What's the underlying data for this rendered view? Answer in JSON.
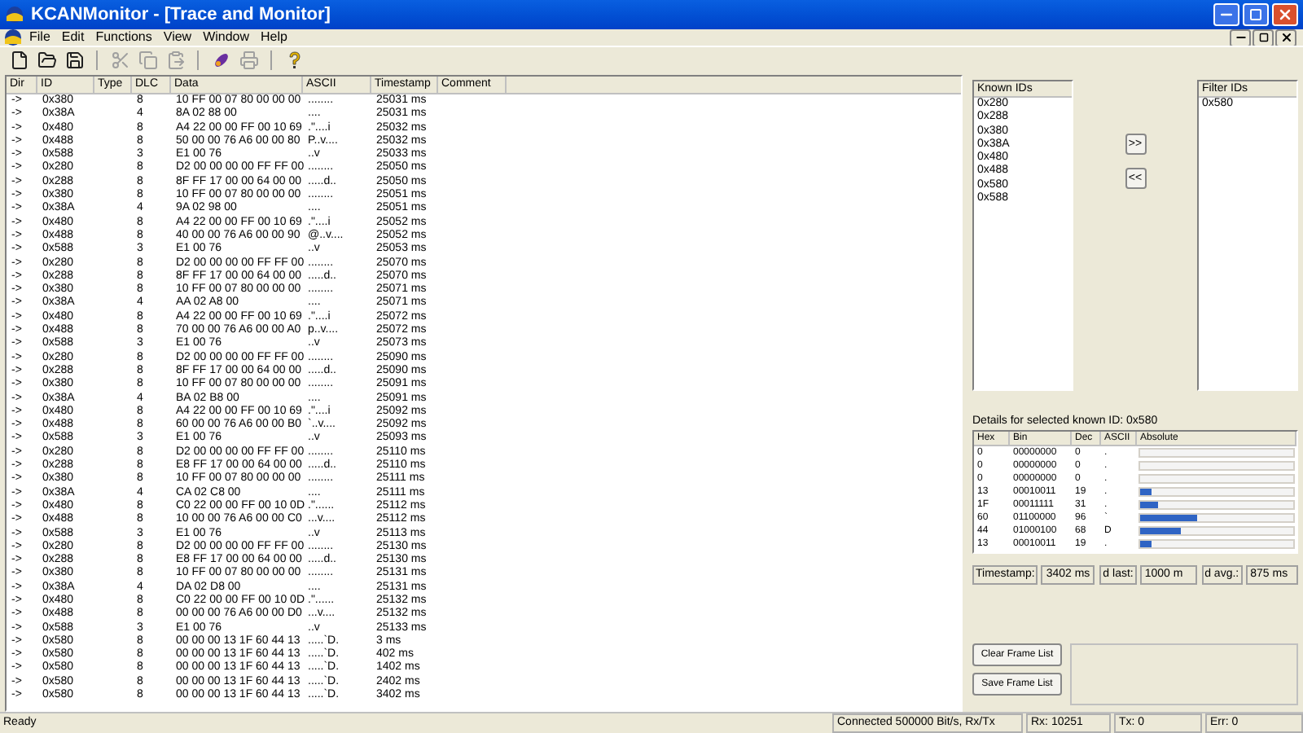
{
  "window": {
    "title": "KCANMonitor - [Trace and Monitor]"
  },
  "menu": [
    "File",
    "Edit",
    "Functions",
    "View",
    "Window",
    "Help"
  ],
  "toolbar": [
    [
      {
        "disabled": false
      },
      {
        "disabled": false
      },
      {
        "disabled": false
      }
    ],
    [
      {
        "disabled": true
      },
      {
        "disabled": true
      },
      {
        "disabled": true
      }
    ],
    [
      {
        "disabled": false
      },
      {
        "disabled": true
      }
    ],
    [
      {
        "disabled": false
      }
    ]
  ],
  "trace": {
    "columns": [
      "Dir",
      "ID",
      "Type",
      "DLC",
      "Data",
      "ASCII",
      "Timestamp",
      "Comment"
    ],
    "rows": [
      {
        "dir": "->",
        "id": "0x380",
        "dlc": "8",
        "data": "10 FF 00 07 80 00 00 00",
        "ascii": "........",
        "timestamp": "25031 ms"
      },
      {
        "dir": "->",
        "id": "0x38A",
        "dlc": "4",
        "data": "8A 02 88 00",
        "ascii": "....",
        "timestamp": "25031 ms"
      },
      {
        "dir": "->",
        "id": "0x480",
        "dlc": "8",
        "data": "A4 22 00 00 FF 00 10 69",
        "ascii": ".\"....i",
        "timestamp": "25032 ms"
      },
      {
        "dir": "->",
        "id": "0x488",
        "dlc": "8",
        "data": "50 00 00 76 A6 00 00 80",
        "ascii": "P..v....",
        "timestamp": "25032 ms"
      },
      {
        "dir": "->",
        "id": "0x588",
        "dlc": "3",
        "data": "E1 00 76",
        "ascii": "..v",
        "timestamp": "25033 ms"
      },
      {
        "dir": "->",
        "id": "0x280",
        "dlc": "8",
        "data": "D2 00 00 00 00 FF FF 00",
        "ascii": "........",
        "timestamp": "25050 ms"
      },
      {
        "dir": "->",
        "id": "0x288",
        "dlc": "8",
        "data": "8F FF 17 00 00 64 00 00",
        "ascii": ".....d..",
        "timestamp": "25050 ms"
      },
      {
        "dir": "->",
        "id": "0x380",
        "dlc": "8",
        "data": "10 FF 00 07 80 00 00 00",
        "ascii": "........",
        "timestamp": "25051 ms"
      },
      {
        "dir": "->",
        "id": "0x38A",
        "dlc": "4",
        "data": "9A 02 98 00",
        "ascii": "....",
        "timestamp": "25051 ms"
      },
      {
        "dir": "->",
        "id": "0x480",
        "dlc": "8",
        "data": "A4 22 00 00 FF 00 10 69",
        "ascii": ".\"....i",
        "timestamp": "25052 ms"
      },
      {
        "dir": "->",
        "id": "0x488",
        "dlc": "8",
        "data": "40 00 00 76 A6 00 00 90",
        "ascii": "@..v....",
        "timestamp": "25052 ms"
      },
      {
        "dir": "->",
        "id": "0x588",
        "dlc": "3",
        "data": "E1 00 76",
        "ascii": "..v",
        "timestamp": "25053 ms"
      },
      {
        "dir": "->",
        "id": "0x280",
        "dlc": "8",
        "data": "D2 00 00 00 00 FF FF 00",
        "ascii": "........",
        "timestamp": "25070 ms"
      },
      {
        "dir": "->",
        "id": "0x288",
        "dlc": "8",
        "data": "8F FF 17 00 00 64 00 00",
        "ascii": ".....d..",
        "timestamp": "25070 ms"
      },
      {
        "dir": "->",
        "id": "0x380",
        "dlc": "8",
        "data": "10 FF 00 07 80 00 00 00",
        "ascii": "........",
        "timestamp": "25071 ms"
      },
      {
        "dir": "->",
        "id": "0x38A",
        "dlc": "4",
        "data": "AA 02 A8 00",
        "ascii": "....",
        "timestamp": "25071 ms"
      },
      {
        "dir": "->",
        "id": "0x480",
        "dlc": "8",
        "data": "A4 22 00 00 FF 00 10 69",
        "ascii": ".\"....i",
        "timestamp": "25072 ms"
      },
      {
        "dir": "->",
        "id": "0x488",
        "dlc": "8",
        "data": "70 00 00 76 A6 00 00 A0",
        "ascii": "p..v....",
        "timestamp": "25072 ms"
      },
      {
        "dir": "->",
        "id": "0x588",
        "dlc": "3",
        "data": "E1 00 76",
        "ascii": "..v",
        "timestamp": "25073 ms"
      },
      {
        "dir": "->",
        "id": "0x280",
        "dlc": "8",
        "data": "D2 00 00 00 00 FF FF 00",
        "ascii": "........",
        "timestamp": "25090 ms"
      },
      {
        "dir": "->",
        "id": "0x288",
        "dlc": "8",
        "data": "8F FF 17 00 00 64 00 00",
        "ascii": ".....d..",
        "timestamp": "25090 ms"
      },
      {
        "dir": "->",
        "id": "0x380",
        "dlc": "8",
        "data": "10 FF 00 07 80 00 00 00",
        "ascii": "........",
        "timestamp": "25091 ms"
      },
      {
        "dir": "->",
        "id": "0x38A",
        "dlc": "4",
        "data": "BA 02 B8 00",
        "ascii": "....",
        "timestamp": "25091 ms"
      },
      {
        "dir": "->",
        "id": "0x480",
        "dlc": "8",
        "data": "A4 22 00 00 FF 00 10 69",
        "ascii": ".\"....i",
        "timestamp": "25092 ms"
      },
      {
        "dir": "->",
        "id": "0x488",
        "dlc": "8",
        "data": "60 00 00 76 A6 00 00 B0",
        "ascii": "`..v....",
        "timestamp": "25092 ms"
      },
      {
        "dir": "->",
        "id": "0x588",
        "dlc": "3",
        "data": "E1 00 76",
        "ascii": "..v",
        "timestamp": "25093 ms"
      },
      {
        "dir": "->",
        "id": "0x280",
        "dlc": "8",
        "data": "D2 00 00 00 00 FF FF 00",
        "ascii": "........",
        "timestamp": "25110 ms"
      },
      {
        "dir": "->",
        "id": "0x288",
        "dlc": "8",
        "data": "E8 FF 17 00 00 64 00 00",
        "ascii": ".....d..",
        "timestamp": "25110 ms"
      },
      {
        "dir": "->",
        "id": "0x380",
        "dlc": "8",
        "data": "10 FF 00 07 80 00 00 00",
        "ascii": "........",
        "timestamp": "25111 ms"
      },
      {
        "dir": "->",
        "id": "0x38A",
        "dlc": "4",
        "data": "CA 02 C8 00",
        "ascii": "....",
        "timestamp": "25111 ms"
      },
      {
        "dir": "->",
        "id": "0x480",
        "dlc": "8",
        "data": "C0 22 00 00 FF 00 10 0D",
        "ascii": ".\"......",
        "timestamp": "25112 ms"
      },
      {
        "dir": "->",
        "id": "0x488",
        "dlc": "8",
        "data": "10 00 00 76 A6 00 00 C0",
        "ascii": "...v....",
        "timestamp": "25112 ms"
      },
      {
        "dir": "->",
        "id": "0x588",
        "dlc": "3",
        "data": "E1 00 76",
        "ascii": "..v",
        "timestamp": "25113 ms"
      },
      {
        "dir": "->",
        "id": "0x280",
        "dlc": "8",
        "data": "D2 00 00 00 00 FF FF 00",
        "ascii": "........",
        "timestamp": "25130 ms"
      },
      {
        "dir": "->",
        "id": "0x288",
        "dlc": "8",
        "data": "E8 FF 17 00 00 64 00 00",
        "ascii": ".....d..",
        "timestamp": "25130 ms"
      },
      {
        "dir": "->",
        "id": "0x380",
        "dlc": "8",
        "data": "10 FF 00 07 80 00 00 00",
        "ascii": "........",
        "timestamp": "25131 ms"
      },
      {
        "dir": "->",
        "id": "0x38A",
        "dlc": "4",
        "data": "DA 02 D8 00",
        "ascii": "....",
        "timestamp": "25131 ms"
      },
      {
        "dir": "->",
        "id": "0x480",
        "dlc": "8",
        "data": "C0 22 00 00 FF 00 10 0D",
        "ascii": ".\"......",
        "timestamp": "25132 ms"
      },
      {
        "dir": "->",
        "id": "0x488",
        "dlc": "8",
        "data": "00 00 00 76 A6 00 00 D0",
        "ascii": "...v....",
        "timestamp": "25132 ms"
      },
      {
        "dir": "->",
        "id": "0x588",
        "dlc": "3",
        "data": "E1 00 76",
        "ascii": "..v",
        "timestamp": "25133 ms"
      },
      {
        "dir": "->",
        "id": "0x580",
        "dlc": "8",
        "data": "00 00 00 13 1F 60 44 13",
        "ascii": ".....`D.",
        "timestamp": "3 ms"
      },
      {
        "dir": "->",
        "id": "0x580",
        "dlc": "8",
        "data": "00 00 00 13 1F 60 44 13",
        "ascii": ".....`D.",
        "timestamp": "402 ms"
      },
      {
        "dir": "->",
        "id": "0x580",
        "dlc": "8",
        "data": "00 00 00 13 1F 60 44 13",
        "ascii": ".....`D.",
        "timestamp": "1402 ms"
      },
      {
        "dir": "->",
        "id": "0x580",
        "dlc": "8",
        "data": "00 00 00 13 1F 60 44 13",
        "ascii": ".....`D.",
        "timestamp": "2402 ms"
      },
      {
        "dir": "->",
        "id": "0x580",
        "dlc": "8",
        "data": "00 00 00 13 1F 60 44 13",
        "ascii": ".....`D.",
        "timestamp": "3402 ms"
      }
    ]
  },
  "known_ids": {
    "heading": "Known IDs",
    "items": [
      "0x280",
      "0x288",
      "0x380",
      "0x38A",
      "0x480",
      "0x488",
      "0x580",
      "0x588"
    ]
  },
  "move_buttons": [
    ">>",
    "<<"
  ],
  "filter_ids": {
    "heading": "Filter IDs",
    "items": [
      "0x580"
    ]
  },
  "details": {
    "title": "Details for selected known ID: 0x580",
    "columns": [
      "Hex",
      "Bin",
      "Dec",
      "ASCII",
      "Absolute"
    ],
    "rows": [
      {
        "hex": "0",
        "bin": "00000000",
        "dec": "0",
        "ascii": "."
      },
      {
        "hex": "0",
        "bin": "00000000",
        "dec": "0",
        "ascii": "."
      },
      {
        "hex": "0",
        "bin": "00000000",
        "dec": "0",
        "ascii": "."
      },
      {
        "hex": "13",
        "bin": "00010011",
        "dec": "19",
        "ascii": ".",
        "level": 0.075
      },
      {
        "hex": "1F",
        "bin": "00011111",
        "dec": "31",
        "ascii": ".",
        "level": 0.122
      },
      {
        "hex": "60",
        "bin": "01100000",
        "dec": "96",
        "ascii": "`",
        "level": 0.376
      },
      {
        "hex": "44",
        "bin": "01000100",
        "dec": "68",
        "ascii": "D",
        "level": 0.267
      },
      {
        "hex": "13",
        "bin": "00010011",
        "dec": "19",
        "ascii": ".",
        "level": 0.075
      }
    ],
    "fields": [
      {
        "label": "Timestamp:",
        "value": "3402 ms"
      },
      {
        "label": "d last:",
        "value": "1000 m"
      },
      {
        "label": "d avg.:",
        "value": "875 ms"
      }
    ]
  },
  "frame_buttons": [
    "Clear Frame List",
    "Save Frame List"
  ],
  "status_bar": [
    "Ready",
    "Connected 500000 Bit/s, Rx/Tx",
    "Rx: 10251",
    "Tx: 0",
    "Err: 0"
  ]
}
